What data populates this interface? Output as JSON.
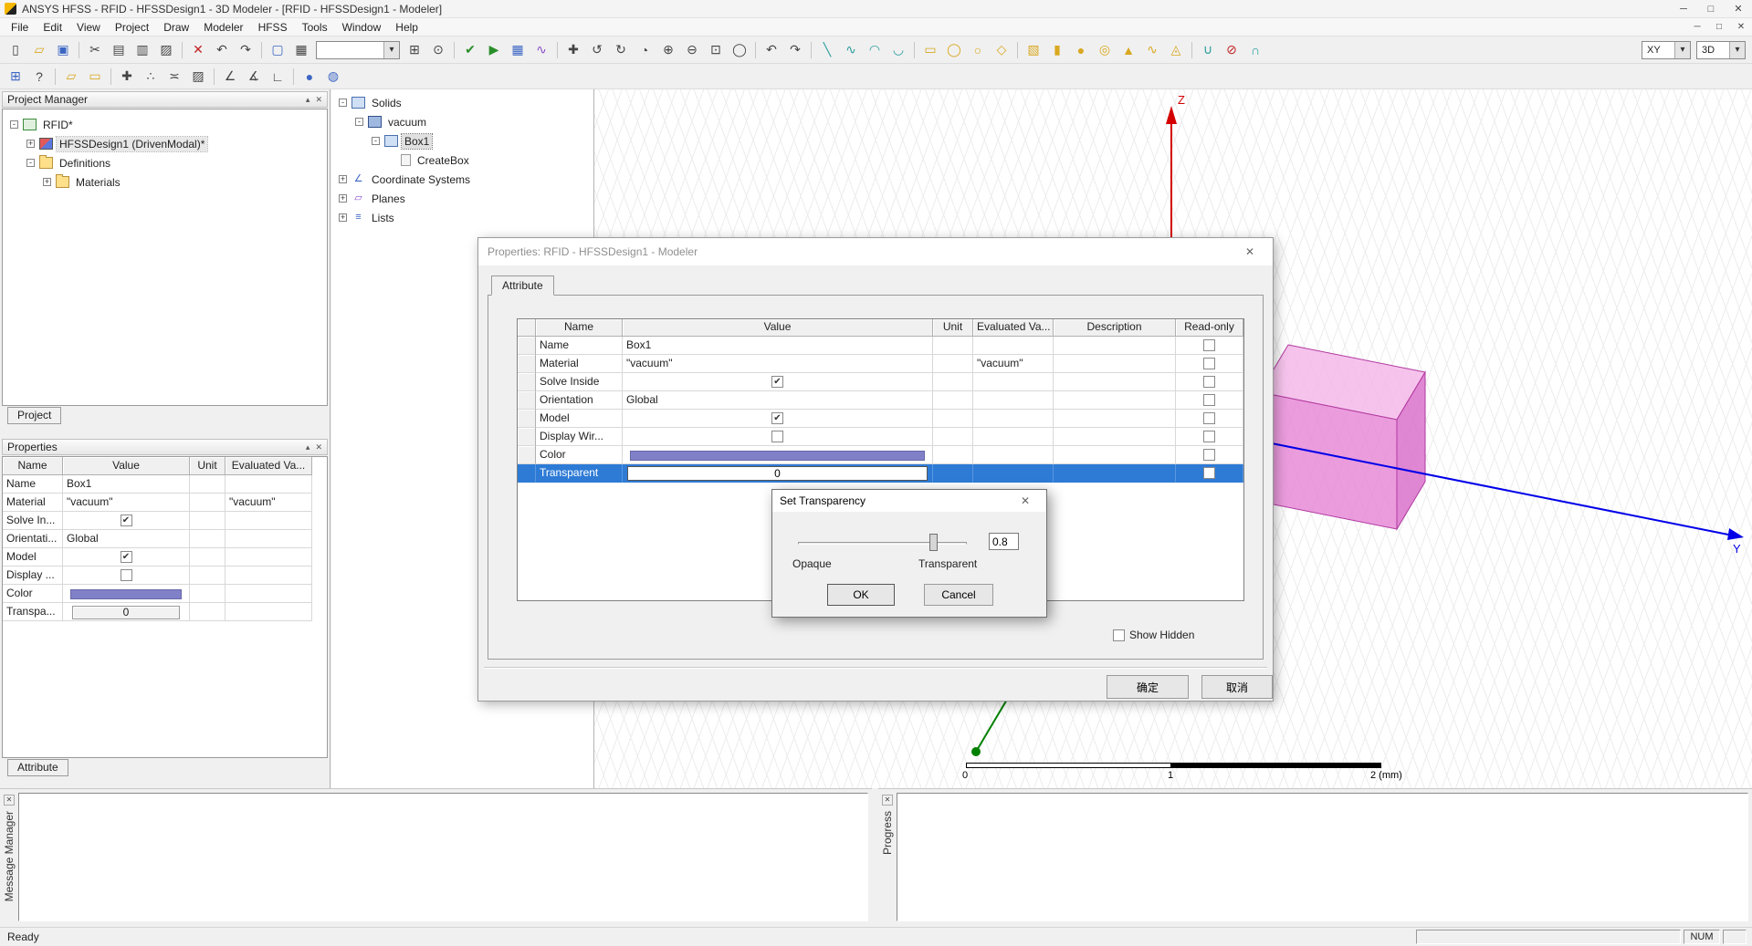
{
  "window": {
    "title": "ANSYS HFSS - RFID - HFSSDesign1 - 3D Modeler - [RFID - HFSSDesign1 - Modeler]",
    "controls": {
      "minimize": "─",
      "maximize": "□",
      "close": "✕"
    },
    "mdi": {
      "minimize": "─",
      "restore": "□",
      "close": "✕"
    }
  },
  "panel_icons": {
    "collapse": "▴",
    "close": "✕"
  },
  "menubar": {
    "items": [
      {
        "name": "menu-item-file",
        "label": "File"
      },
      {
        "name": "menu-item-edit",
        "label": "Edit"
      },
      {
        "name": "menu-item-view",
        "label": "View"
      },
      {
        "name": "menu-item-project",
        "label": "Project"
      },
      {
        "name": "menu-item-draw",
        "label": "Draw"
      },
      {
        "name": "menu-item-modeler",
        "label": "Modeler"
      },
      {
        "name": "menu-item-hfss",
        "label": "HFSS"
      },
      {
        "name": "menu-item-tools",
        "label": "Tools"
      },
      {
        "name": "menu-item-window",
        "label": "Window"
      },
      {
        "name": "menu-item-help",
        "label": "Help"
      }
    ]
  },
  "toolbar1": {
    "items": [
      {
        "name": "new-file-button",
        "glyph": "▯"
      },
      {
        "name": "open-file-button",
        "glyph": "▱",
        "cls": "tbtn c-yellow"
      },
      {
        "name": "save-button",
        "glyph": "▣",
        "cls": "tbtn c-blue"
      },
      {
        "name": "toolbar-separator",
        "cls": "tsep",
        "inter": "false"
      },
      {
        "name": "cut-button",
        "glyph": "✂"
      },
      {
        "name": "copy-button",
        "glyph": "▤"
      },
      {
        "name": "paste-button",
        "glyph": "▥"
      },
      {
        "name": "print-button",
        "glyph": "▨"
      },
      {
        "name": "toolbar-separator",
        "cls": "tsep",
        "inter": "false"
      },
      {
        "name": "delete-button",
        "glyph": "✕",
        "cls": "tbtn c-red"
      },
      {
        "name": "undo-button",
        "glyph": "↶"
      },
      {
        "name": "redo-button",
        "glyph": "↷"
      },
      {
        "name": "toolbar-separator",
        "cls": "tsep",
        "inter": "false"
      },
      {
        "name": "select-object-button",
        "glyph": "▢",
        "cls": "tbtn c-blue"
      },
      {
        "name": "select-face-button",
        "glyph": "▦"
      },
      {
        "name": "selection-mode-combo",
        "glyph": "",
        "cls": "tcombo"
      },
      {
        "name": "snap-mode-button",
        "glyph": "⊞"
      },
      {
        "name": "reference-cs-button",
        "glyph": "⊙"
      },
      {
        "name": "toolbar-separator",
        "cls": "tsep",
        "inter": "false"
      },
      {
        "name": "validate-button",
        "glyph": "✔",
        "cls": "tbtn c-green"
      },
      {
        "name": "analyze-all-button",
        "glyph": "▶",
        "cls": "tbtn c-green"
      },
      {
        "name": "solution-data-button",
        "glyph": "▦",
        "cls": "tbtn c-blue"
      },
      {
        "name": "results-button",
        "glyph": "∿",
        "cls": "tbtn c-purple"
      },
      {
        "name": "toolbar-separator",
        "cls": "tsep",
        "inter": "false"
      },
      {
        "name": "pan-button",
        "glyph": "✚"
      },
      {
        "name": "rotate-model-button",
        "glyph": "↺"
      },
      {
        "name": "rotate-view-button",
        "glyph": "↻"
      },
      {
        "name": "dynamic-zoom-button",
        "glyph": "◔"
      },
      {
        "name": "zoom-in-button",
        "glyph": "⊕"
      },
      {
        "name": "zoom-out-button",
        "glyph": "⊖"
      },
      {
        "name": "zoom-window-button",
        "glyph": "⊡"
      },
      {
        "name": "fit-all-button",
        "glyph": "◯"
      },
      {
        "name": "toolbar-separator",
        "cls": "tsep",
        "inter": "false"
      },
      {
        "name": "view-undo-button",
        "glyph": "↶"
      },
      {
        "name": "view-redo-button",
        "glyph": "↷"
      },
      {
        "name": "toolbar-separator",
        "cls": "tsep",
        "inter": "false"
      },
      {
        "name": "draw-line-button",
        "glyph": "╲",
        "cls": "tbtn c-teal"
      },
      {
        "name": "draw-spline-button",
        "glyph": "∿",
        "cls": "tbtn c-teal"
      },
      {
        "name": "draw-arc-center-button",
        "glyph": "◠",
        "cls": "tbtn c-teal"
      },
      {
        "name": "draw-arc-3point-button",
        "glyph": "◡",
        "cls": "tbtn c-teal"
      },
      {
        "name": "toolbar-separator",
        "cls": "tsep",
        "inter": "false"
      },
      {
        "name": "draw-rectangle-button",
        "glyph": "▭",
        "cls": "tbtn c-yellow"
      },
      {
        "name": "draw-ellipse-button",
        "glyph": "◯",
        "cls": "tbtn c-yellow"
      },
      {
        "name": "draw-circle-button",
        "glyph": "○",
        "cls": "tbtn c-yellow"
      },
      {
        "name": "draw-polygon-button",
        "glyph": "◇",
        "cls": "tbtn c-yellow"
      },
      {
        "name": "toolbar-separator",
        "cls": "tsep",
        "inter": "false"
      },
      {
        "name": "draw-box-button",
        "glyph": "▧",
        "cls": "tbtn c-yellow"
      },
      {
        "name": "draw-cylinder-button",
        "glyph": "▮",
        "cls": "tbtn c-yellow"
      },
      {
        "name": "draw-sphere-button",
        "glyph": "●",
        "cls": "tbtn c-yellow"
      },
      {
        "name": "draw-torus-button",
        "glyph": "◎",
        "cls": "tbtn c-yellow"
      },
      {
        "name": "draw-cone-button",
        "glyph": "▲",
        "cls": "tbtn c-yellow"
      },
      {
        "name": "draw-helix-button",
        "glyph": "∿",
        "cls": "tbtn c-yellow"
      },
      {
        "name": "draw-polyhedron-button",
        "glyph": "◬",
        "cls": "tbtn c-yellow"
      },
      {
        "name": "toolbar-separator",
        "cls": "tsep",
        "inter": "false"
      },
      {
        "name": "boolean-unite-button",
        "glyph": "∪",
        "cls": "tbtn c-teal"
      },
      {
        "name": "boolean-subtract-button",
        "glyph": "⊘",
        "cls": "tbtn c-red"
      },
      {
        "name": "boolean-intersect-button",
        "glyph": "∩",
        "cls": "tbtn c-teal"
      },
      {
        "name": "toolbar-spacer",
        "cls": "tspacer",
        "inter": "false"
      },
      {
        "name": "working-plane-combo",
        "glyph": "XY",
        "cls": "tcombo sm"
      },
      {
        "name": "drawing-mode-combo",
        "glyph": "3D",
        "cls": "tcombo sm"
      }
    ]
  },
  "toolbar2": {
    "items": [
      {
        "name": "grid-settings-button",
        "glyph": "⊞",
        "cls": "tbtn c-blue"
      },
      {
        "name": "context-help-button",
        "glyph": "?"
      },
      {
        "name": "toolbar-separator",
        "cls": "tsep",
        "inter": "false"
      },
      {
        "name": "new-window-button",
        "glyph": "▱",
        "cls": "tbtn c-yellow"
      },
      {
        "name": "tile-windows-button",
        "glyph": "▭",
        "cls": "tbtn c-yellow"
      },
      {
        "name": "toolbar-separator",
        "cls": "tsep",
        "inter": "false"
      },
      {
        "name": "snap-to-grid-button",
        "glyph": "✚"
      },
      {
        "name": "snap-to-vertex-button",
        "glyph": "∴"
      },
      {
        "name": "snap-to-edge-button",
        "glyph": "≍"
      },
      {
        "name": "snap-to-face-button",
        "glyph": "▨"
      },
      {
        "name": "toolbar-separator",
        "cls": "tsep",
        "inter": "false"
      },
      {
        "name": "measure-position-button",
        "glyph": "∠"
      },
      {
        "name": "measure-length-button",
        "glyph": "∡"
      },
      {
        "name": "measure-area-button",
        "glyph": "∟"
      },
      {
        "name": "toolbar-separator",
        "cls": "tsep",
        "inter": "false"
      },
      {
        "name": "boundary-display-button",
        "glyph": "●",
        "cls": "tbtn c-blue"
      },
      {
        "name": "field-overlay-button",
        "glyph": "◍",
        "cls": "tbtn c-blue"
      }
    ]
  },
  "project_manager": {
    "title": "Project Manager",
    "tab": "Project",
    "tree": [
      {
        "name": "tree-item-rfid",
        "label": "RFID*",
        "level": 0,
        "expander": "-",
        "iconcls": "nicon i-project",
        "glyph": ""
      },
      {
        "name": "tree-item-hfssdesign1",
        "label": "HFSSDesign1 (DrivenModal)*",
        "level": 1,
        "expander": "+",
        "iconcls": "nicon i-design",
        "glyph": "",
        "cls": "titem hl"
      },
      {
        "name": "tree-item-definitions",
        "label": "Definitions",
        "level": 1,
        "expander": "-",
        "iconcls": "nicon i-folder",
        "glyph": ""
      },
      {
        "name": "tree-item-materials",
        "label": "Materials",
        "level": 2,
        "expander": "+",
        "iconcls": "nicon i-folder",
        "glyph": ""
      }
    ]
  },
  "model_tree": {
    "tree": [
      {
        "name": "tree-item-solids",
        "label": "Solids",
        "level": 0,
        "expander": "-",
        "iconcls": "nicon i-cube",
        "glyph": ""
      },
      {
        "name": "tree-item-vacuum",
        "label": "vacuum",
        "level": 1,
        "expander": "-",
        "iconcls": "nicon i-cubedark",
        "glyph": ""
      },
      {
        "name": "tree-item-box1",
        "label": "Box1",
        "level": 2,
        "expander": "-",
        "iconcls": "nicon i-cube",
        "glyph": "",
        "cls": "titem focused"
      },
      {
        "name": "tree-item-createbox",
        "label": "CreateBox",
        "level": 3,
        "expander": "",
        "iconcls": "nicon i-cmd",
        "glyph": ""
      },
      {
        "name": "tree-item-coordinate-systems",
        "label": "Coordinate Systems",
        "level": 0,
        "expander": "+",
        "iconcls": "nicon gi c-blue",
        "glyph": "∠"
      },
      {
        "name": "tree-item-planes",
        "label": "Planes",
        "level": 0,
        "expander": "+",
        "iconcls": "nicon gi c-purple",
        "glyph": "▱"
      },
      {
        "name": "tree-item-lists",
        "label": "Lists",
        "level": 0,
        "expander": "+",
        "iconcls": "nicon gi c-blue",
        "glyph": "≡"
      }
    ]
  },
  "properties_panel": {
    "title": "Properties",
    "tab": "Attribute",
    "columns": [
      "Name",
      "Value",
      "Unit",
      "Evaluated Va..."
    ],
    "rows": {
      "name_row": {
        "label": "Name",
        "value": "Box1"
      },
      "material_row": {
        "label": "Material",
        "value": "\"vacuum\"",
        "evaluated": "\"vacuum\""
      },
      "solve_row": {
        "label": "Solve In...",
        "check": "✔"
      },
      "orientation_row": {
        "label": "Orientati...",
        "value": "Global"
      },
      "model_row": {
        "label": "Model",
        "check": "✔"
      },
      "display_row": {
        "label": "Display ...",
        "check": ""
      },
      "color_row": {
        "label": "Color",
        "color": "#8080C8"
      },
      "transparent_row": {
        "label": "Transpa...",
        "value": "0"
      }
    }
  },
  "properties_dialog": {
    "title": "Properties: RFID - HFSSDesign1 - Modeler",
    "tab": "Attribute",
    "columns": [
      "",
      "Name",
      "Value",
      "Unit",
      "Evaluated Va...",
      "Description",
      "Read-only"
    ],
    "rows": {
      "name": {
        "label": "Name",
        "value": "Box1"
      },
      "material": {
        "label": "Material",
        "value": "\"vacuum\"",
        "evaluated": "\"vacuum\""
      },
      "solve_inside": {
        "label": "Solve Inside",
        "check": "✔"
      },
      "orientation": {
        "label": "Orientation",
        "value": "Global"
      },
      "model": {
        "label": "Model",
        "check": "✔"
      },
      "display_wireframe": {
        "label": "Display Wir...",
        "check": ""
      },
      "color": {
        "label": "Color",
        "color": "#8080C8"
      },
      "transparent": {
        "label": "Transparent",
        "value": "0"
      }
    },
    "show_hidden_label": "Show Hidden",
    "ok_label": "确定",
    "cancel_label": "取消"
  },
  "transparency_dialog": {
    "title": "Set Transparency",
    "value": "0.8",
    "opaque_label": "Opaque",
    "transparent_label": "Transparent",
    "ok_label": "OK",
    "cancel_label": "Cancel"
  },
  "viewport": {
    "axis_z_label": "Z",
    "axis_y_label": "Y",
    "scale_labels": [
      "0",
      "1",
      "2 (mm)"
    ]
  },
  "colors": {
    "selection": "#2E7BD6",
    "swatch": "#8080C8",
    "axis_x": "#008000",
    "axis_y": "#0000E8",
    "axis_z": "#D40000",
    "box_top": "#F4B9E9",
    "box_side": "#E78BD7",
    "box_right": "#DB72CB",
    "box_edge": "#B13AA0"
  },
  "message_manager": {
    "title": "Message Manager"
  },
  "progress": {
    "title": "Progress"
  },
  "statusbar": {
    "ready": "Ready",
    "num": "NUM"
  }
}
